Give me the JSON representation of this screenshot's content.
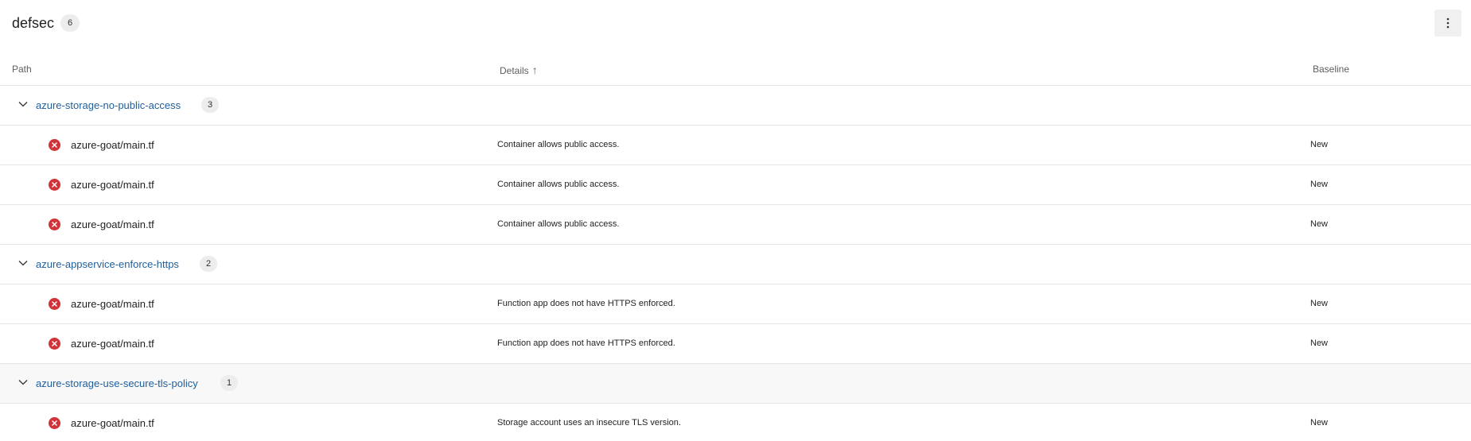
{
  "header": {
    "title": "defsec",
    "count": "6",
    "more_icon": "more-vertical-icon"
  },
  "columns": {
    "path": "Path",
    "details": "Details",
    "details_sort_icon": "arrow-up-icon",
    "baseline": "Baseline"
  },
  "groups": [
    {
      "name": "azure-storage-no-public-access",
      "count": "3",
      "rows": [
        {
          "path": "azure-goat/main.tf",
          "details": "Container allows public access.",
          "baseline": "New"
        },
        {
          "path": "azure-goat/main.tf",
          "details": "Container allows public access.",
          "baseline": "New"
        },
        {
          "path": "azure-goat/main.tf",
          "details": "Container allows public access.",
          "baseline": "New"
        }
      ]
    },
    {
      "name": "azure-appservice-enforce-https",
      "count": "2",
      "rows": [
        {
          "path": "azure-goat/main.tf",
          "details": "Function app does not have HTTPS enforced.",
          "baseline": "New"
        },
        {
          "path": "azure-goat/main.tf",
          "details": "Function app does not have HTTPS enforced.",
          "baseline": "New"
        }
      ]
    },
    {
      "name": "azure-storage-use-secure-tls-policy",
      "count": "1",
      "rows": [
        {
          "path": "azure-goat/main.tf",
          "details": "Storage account uses an insecure TLS version.",
          "baseline": "New"
        }
      ]
    }
  ],
  "colors": {
    "link": "#1f5e9c",
    "error": "#d13438",
    "badge_bg": "#ededed"
  }
}
